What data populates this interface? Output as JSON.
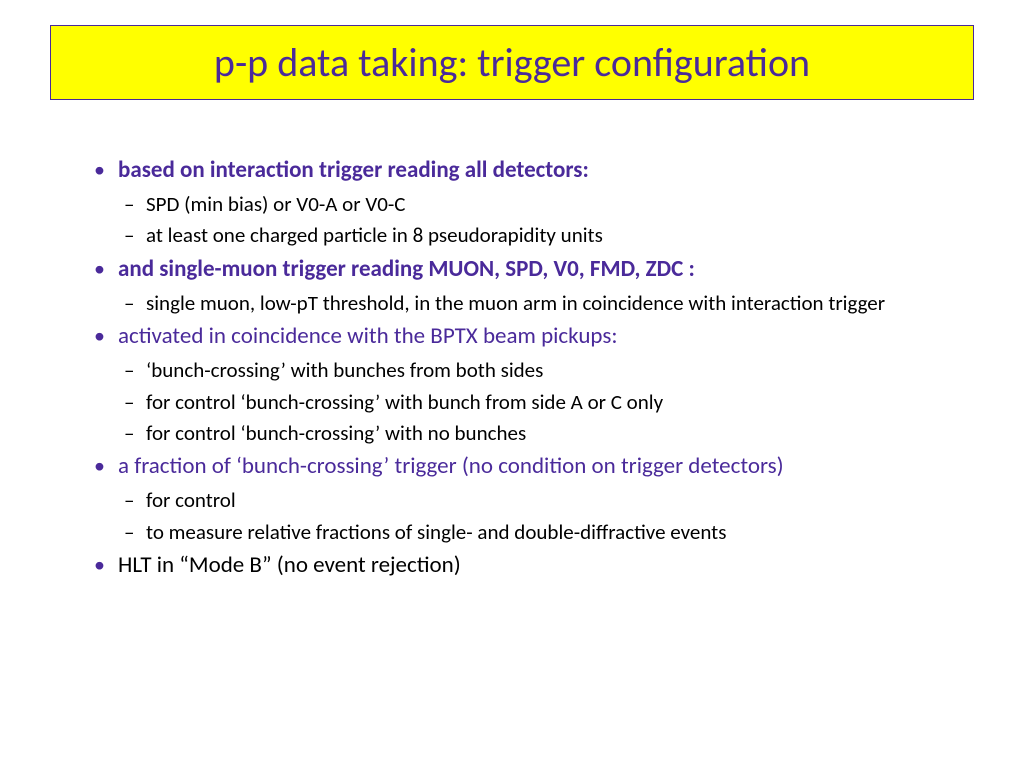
{
  "title": "p-p data taking: trigger configuration",
  "bullets": [
    {
      "text": "based on interaction trigger reading all detectors:",
      "styleClass": "bold-purple",
      "sub": [
        "SPD (min bias)  or  V0-A or V0-C",
        "at least one charged particle in 8 pseudorapidity units"
      ]
    },
    {
      "text": "and single-muon trigger reading MUON, SPD, V0, FMD, ZDC :",
      "styleClass": "bold-purple",
      "sub": [
        "single muon, low-pT threshold,  in the muon arm in coincidence with interaction trigger"
      ]
    },
    {
      "text": "activated in coincidence with the BPTX beam pickups:",
      "styleClass": "reg-purple",
      "sub": [
        "‘bunch-crossing’ with bunches from both sides",
        "for control ‘bunch-crossing’ with bunch from side A or C only",
        "for control ‘bunch-crossing’ with no bunches"
      ]
    },
    {
      "text": "a fraction of ‘bunch-crossing’ trigger (no condition on trigger detectors)",
      "styleClass": "reg-purple",
      "sub": [
        "for control",
        "to measure relative fractions of single- and double-diffractive events"
      ]
    },
    {
      "text": "HLT in “Mode B” (no event rejection)",
      "styleClass": "black",
      "sub": []
    }
  ]
}
